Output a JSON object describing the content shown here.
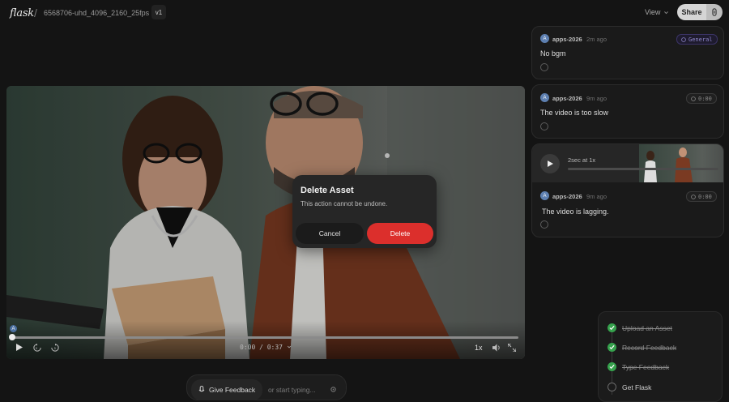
{
  "topbar": {
    "logo": "flask",
    "separator": "/",
    "filename": "6568706-uhd_4096_2160_25fps",
    "version": "v1",
    "view_label": "View",
    "share_label": "Share"
  },
  "player": {
    "marker_initial": "A",
    "timecode": "0:00 / 0:37",
    "speed": "1x",
    "progress": 0
  },
  "dialog": {
    "title": "Delete Asset",
    "body": "This action cannot be undone.",
    "cancel_label": "Cancel",
    "delete_label": "Delete",
    "delete_color": "#dc2f2c"
  },
  "feedback_bar": {
    "button_label": "Give Feedback",
    "placeholder": "or start typing..."
  },
  "comments": [
    {
      "initial": "A",
      "author": "apps-2026",
      "ago": "2m ago",
      "badge": "General",
      "text": "No bgm"
    },
    {
      "initial": "A",
      "author": "apps-2026",
      "ago": "9m ago",
      "badge": "0:00",
      "text": "The video is too slow"
    },
    {
      "initial": "A",
      "author": "apps-2026",
      "ago": "9m ago",
      "badge": "0:00",
      "text": "The video is lagging.",
      "audio_label": "2sec at 1x"
    }
  ],
  "checklist": [
    {
      "label": "Upload an Asset",
      "done": true
    },
    {
      "label": "Record Feedback",
      "done": true
    },
    {
      "label": "Type Feedback",
      "done": true
    },
    {
      "label": "Get Flask",
      "done": false
    }
  ],
  "colors": {
    "accent_check": "#36a24d",
    "avatar": "#5d7fb0",
    "general_badge": "#8d85c9"
  }
}
